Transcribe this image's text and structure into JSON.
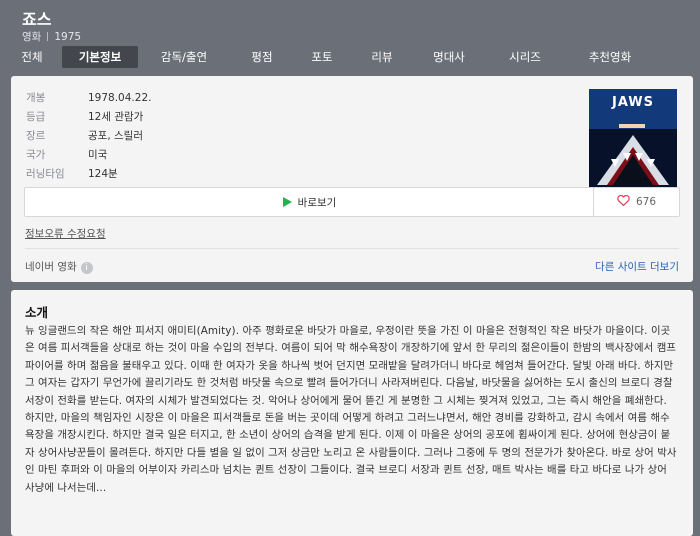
{
  "movie": {
    "title": "죠스",
    "category": "영화",
    "year": "1975"
  },
  "tabs": [
    {
      "label": "전체"
    },
    {
      "label": "기본정보",
      "active": true
    },
    {
      "label": "감독/출연"
    },
    {
      "label": "평점"
    },
    {
      "label": "포토"
    },
    {
      "label": "리뷰"
    },
    {
      "label": "명대사"
    },
    {
      "label": "시리즈"
    },
    {
      "label": "추천영화"
    }
  ],
  "info": [
    {
      "key": "개봉",
      "value": "1978.04.22."
    },
    {
      "key": "등급",
      "value": "12세 관람가"
    },
    {
      "key": "장르",
      "value": "공포, 스릴러"
    },
    {
      "key": "국가",
      "value": "미국"
    },
    {
      "key": "러닝타임",
      "value": "124분"
    }
  ],
  "poster": {
    "text": "JAWS"
  },
  "watch_button": {
    "label": "바로보기",
    "icon": "play-icon",
    "icon_color": "#22b14c"
  },
  "like_button": {
    "count": "676",
    "icon": "heart-icon",
    "icon_color": "#e2445c"
  },
  "report_link": "정보오류 수정요청",
  "naver_label": "네이버 영화",
  "more_link": "다른 사이트 더보기",
  "intro": {
    "title": "소개",
    "text": "뉴 잉글랜드의 작은 해안 피서지 애미티(Amity). 아주 평화로운 바닷가 마을로, 우정이란 뜻을 가진 이 마을은 전형적인 작은 바닷가 마을이다. 이곳은 여름 피서객들을 상대로 하는 것이 마을 수입의 전부다. 여름이 되어 막 해수욕장이 개장하기에 앞서 한 무리의 젊은이들이 한밤의 백사장에서 캠프파이어를 하며 젊음을 불태우고 있다. 이때 한 여자가 옷을 하나씩 벗어 던지면 모래밭을 달려가더니 바다로 헤엄쳐 들어간다. 달빛 아래 바다. 하지만 그 여자는 갑자기 무언가에 끌리기라도 한 것처럼 바닷물 속으로 빨려 들어가더니 사라져버린다. 다음날, 바닷물을 싫어하는 도시 출신의 브로디 경찰서장이 전화를 받는다. 여자의 시체가 발견되었다는 것. 악어나 상어에게 물어 뜯긴 게 분명한 그 시체는 찢겨져 있었고, 그는 즉시 해안을 폐쇄한다. 하지만, 마을의 책임자인 시장은 이 마을은 피서객들로 돈을 버는 곳이데 어떻게 하려고 그러느냐면서, 해안 경비를 강화하고, 감시 속에서 여름 해수욕장을 개장시킨다. 하지만 결국 일은 터지고, 한 소년이 상어의 습격을 받게 된다. 이제 이 마을은 상어의 공포에 휩싸이게 된다. 상어에 현상금이 붙자 상어사냥꾼들이 몰려든다. 하지만 다들 별을 일 없이 그저 상금만 노리고 온 사람들이다. 그러나 그중에 두 명의 전문가가 찾아온다. 바로 상어 박사인 마틴 후퍼와 이 마을의 어부이자 카리스마 넘치는 퀸트 선장이 그들이다. 결국 브로디 서장과 퀸트 선장, 매트 박사는 배를 타고 바다로 나가 상어 사냥에 나서는데..."
  }
}
